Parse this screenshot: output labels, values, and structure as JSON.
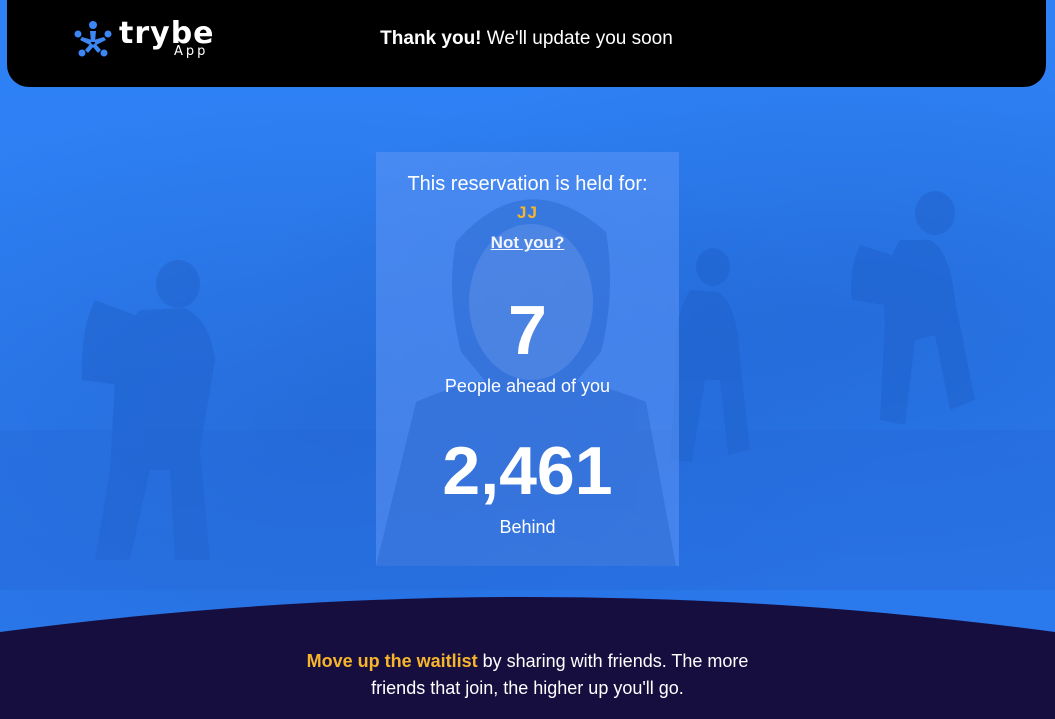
{
  "colors": {
    "brand_blue": "#2a7cf2",
    "accent_yellow": "#f7b52c",
    "header_bg": "#000000",
    "footer_bg": "#160e3f"
  },
  "header": {
    "logo_word": "trybe",
    "logo_sub": "App",
    "logo_icon": "trybe-people-icon",
    "thanks_bold": "Thank you!",
    "thanks_rest": "We'll update you soon"
  },
  "card": {
    "held_label": "This reservation is held for:",
    "name": "JJ",
    "not_you_link": "Not you?",
    "ahead_count": "7",
    "ahead_label": "People ahead of you",
    "behind_count": "2,461",
    "behind_label": "Behind"
  },
  "footer": {
    "highlight": "Move up the waitlist",
    "line1_rest": "by sharing with friends. The more",
    "line2": "friends that join, the higher up you'll go."
  }
}
